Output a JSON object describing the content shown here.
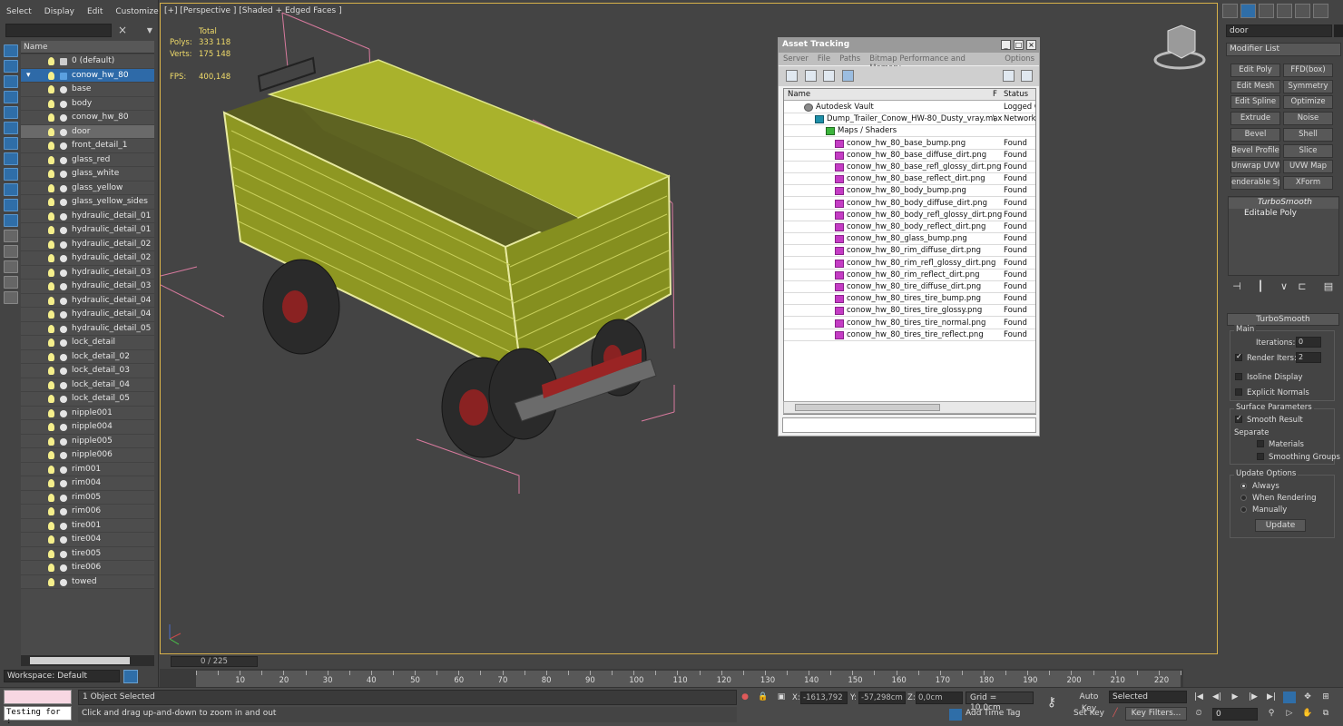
{
  "scene_explorer": {
    "menu": [
      "Select",
      "Display",
      "Edit",
      "Customize"
    ],
    "column_name": "Name",
    "items": [
      {
        "label": "0 (default)",
        "level": 1
      },
      {
        "label": "conow_hw_80",
        "level": 1
      },
      {
        "label": "base",
        "level": 2
      },
      {
        "label": "body",
        "level": 2
      },
      {
        "label": "conow_hw_80",
        "level": 2
      },
      {
        "label": "door",
        "level": 2
      },
      {
        "label": "front_detail_1",
        "level": 2
      },
      {
        "label": "glass_red",
        "level": 2
      },
      {
        "label": "glass_white",
        "level": 2
      },
      {
        "label": "glass_yellow",
        "level": 2
      },
      {
        "label": "glass_yellow_sides",
        "level": 2
      },
      {
        "label": "hydraulic_detail_01",
        "level": 2
      },
      {
        "label": "hydraulic_detail_01",
        "level": 2
      },
      {
        "label": "hydraulic_detail_02",
        "level": 2
      },
      {
        "label": "hydraulic_detail_02",
        "level": 2
      },
      {
        "label": "hydraulic_detail_03",
        "level": 2
      },
      {
        "label": "hydraulic_detail_03",
        "level": 2
      },
      {
        "label": "hydraulic_detail_04",
        "level": 2
      },
      {
        "label": "hydraulic_detail_04",
        "level": 2
      },
      {
        "label": "hydraulic_detail_05",
        "level": 2
      },
      {
        "label": "lock_detail",
        "level": 2
      },
      {
        "label": "lock_detail_02",
        "level": 2
      },
      {
        "label": "lock_detail_03",
        "level": 2
      },
      {
        "label": "lock_detail_04",
        "level": 2
      },
      {
        "label": "lock_detail_05",
        "level": 2
      },
      {
        "label": "nipple001",
        "level": 2
      },
      {
        "label": "nipple004",
        "level": 2
      },
      {
        "label": "nipple005",
        "level": 2
      },
      {
        "label": "nipple006",
        "level": 2
      },
      {
        "label": "rim001",
        "level": 2
      },
      {
        "label": "rim004",
        "level": 2
      },
      {
        "label": "rim005",
        "level": 2
      },
      {
        "label": "rim006",
        "level": 2
      },
      {
        "label": "tire001",
        "level": 2
      },
      {
        "label": "tire004",
        "level": 2
      },
      {
        "label": "tire005",
        "level": 2
      },
      {
        "label": "tire006",
        "level": 2
      },
      {
        "label": "towed",
        "level": 2
      }
    ],
    "workspace": "Workspace: Default"
  },
  "viewport": {
    "label": "[+] [Perspective ] [Shaded + Edged Faces ]",
    "stats": {
      "total_label": "Total",
      "polys_label": "Polys:",
      "polys": "333 118",
      "verts_label": "Verts:",
      "verts": "175 148",
      "fps_label": "FPS:",
      "fps": "400,148"
    }
  },
  "asset_tracking": {
    "title": "Asset Tracking",
    "menu": [
      "Server",
      "File",
      "Paths",
      "Bitmap Performance and Memory",
      "Options"
    ],
    "col_name": "Name",
    "col_f": "F",
    "col_status": "Status",
    "rows": [
      {
        "name": "Autodesk Vault",
        "f": "",
        "status": "Logged O",
        "indent": 1,
        "kind": "vault"
      },
      {
        "name": "Dump_Trailer_Conow_HW-80_Dusty_vray.max",
        "f": "\\",
        "status": "Network",
        "indent": 2,
        "kind": "max"
      },
      {
        "name": "Maps / Shaders",
        "f": "",
        "status": "",
        "indent": 3,
        "kind": "maps"
      },
      {
        "name": "conow_hw_80_base_bump.png",
        "f": "",
        "status": "Found",
        "indent": 4,
        "kind": "png"
      },
      {
        "name": "conow_hw_80_base_diffuse_dirt.png",
        "f": "",
        "status": "Found",
        "indent": 4,
        "kind": "png"
      },
      {
        "name": "conow_hw_80_base_refl_glossy_dirt.png",
        "f": "",
        "status": "Found",
        "indent": 4,
        "kind": "png"
      },
      {
        "name": "conow_hw_80_base_reflect_dirt.png",
        "f": "",
        "status": "Found",
        "indent": 4,
        "kind": "png"
      },
      {
        "name": "conow_hw_80_body_bump.png",
        "f": "",
        "status": "Found",
        "indent": 4,
        "kind": "png"
      },
      {
        "name": "conow_hw_80_body_diffuse_dirt.png",
        "f": "",
        "status": "Found",
        "indent": 4,
        "kind": "png"
      },
      {
        "name": "conow_hw_80_body_refl_glossy_dirt.png",
        "f": "",
        "status": "Found",
        "indent": 4,
        "kind": "png"
      },
      {
        "name": "conow_hw_80_body_reflect_dirt.png",
        "f": "",
        "status": "Found",
        "indent": 4,
        "kind": "png"
      },
      {
        "name": "conow_hw_80_glass_bump.png",
        "f": "",
        "status": "Found",
        "indent": 4,
        "kind": "png"
      },
      {
        "name": "conow_hw_80_rim_diffuse_dirt.png",
        "f": "",
        "status": "Found",
        "indent": 4,
        "kind": "png"
      },
      {
        "name": "conow_hw_80_rim_refl_glossy_dirt.png",
        "f": "",
        "status": "Found",
        "indent": 4,
        "kind": "png"
      },
      {
        "name": "conow_hw_80_rim_reflect_dirt.png",
        "f": "",
        "status": "Found",
        "indent": 4,
        "kind": "png"
      },
      {
        "name": "conow_hw_80_tire_diffuse_dirt.png",
        "f": "",
        "status": "Found",
        "indent": 4,
        "kind": "png"
      },
      {
        "name": "conow_hw_80_tires_tire_bump.png",
        "f": "",
        "status": "Found",
        "indent": 4,
        "kind": "png"
      },
      {
        "name": "conow_hw_80_tires_tire_glossy.png",
        "f": "",
        "status": "Found",
        "indent": 4,
        "kind": "png"
      },
      {
        "name": "conow_hw_80_tires_tire_normal.png",
        "f": "",
        "status": "Found",
        "indent": 4,
        "kind": "png"
      },
      {
        "name": "conow_hw_80_tires_tire_reflect.png",
        "f": "",
        "status": "Found",
        "indent": 4,
        "kind": "png"
      }
    ]
  },
  "command_panel": {
    "object_name": "door",
    "modifier_list": "Modifier List",
    "modifier_buttons": [
      "Edit Poly",
      "FFD(box)",
      "Edit Mesh",
      "Symmetry",
      "Edit Spline",
      "Optimize",
      "Extrude",
      "Noise",
      "Bevel",
      "Shell",
      "Bevel Profile",
      "Slice",
      "Unwrap UVW",
      "UVW Map",
      "enderable Splir",
      "XForm"
    ],
    "stack": [
      "TurboSmooth",
      "Editable Poly"
    ],
    "rollout_title": "TurboSmooth",
    "main_group": "Main",
    "iterations_label": "Iterations:",
    "iterations": "0",
    "render_iters_label": "Render Iters:",
    "render_iters": "2",
    "isoline": "Isoline Display",
    "explicit": "Explicit Normals",
    "surface_group": "Surface Parameters",
    "smooth_result": "Smooth Result",
    "separate": "Separate",
    "materials": "Materials",
    "smoothing_groups": "Smoothing Groups",
    "update_group": "Update Options",
    "always": "Always",
    "when_rendering": "When Rendering",
    "manually": "Manually",
    "update_btn": "Update"
  },
  "timeline": {
    "slider": "0 / 225",
    "ticks": [
      "10",
      "20",
      "30",
      "40",
      "50",
      "60",
      "70",
      "80",
      "90",
      "100",
      "110",
      "120",
      "130",
      "140",
      "150",
      "160",
      "170",
      "180",
      "190",
      "200",
      "210",
      "220"
    ]
  },
  "status_bar": {
    "maxscript": "Testing for :",
    "selection": "1 Object Selected",
    "prompt": "Click and drag up-and-down to zoom in and out",
    "x_label": "X:",
    "x": "-1613,792",
    "y_label": "Y:",
    "y": "-57,298cm",
    "z_label": "Z:",
    "z": "0,0cm",
    "grid": "Grid = 10,0cm",
    "add_time_tag": "Add Time Tag",
    "auto_key": "Auto Key",
    "set_key": "Set Key",
    "selected": "Selected",
    "key_filters": "Key Filters...",
    "frame": "0"
  }
}
